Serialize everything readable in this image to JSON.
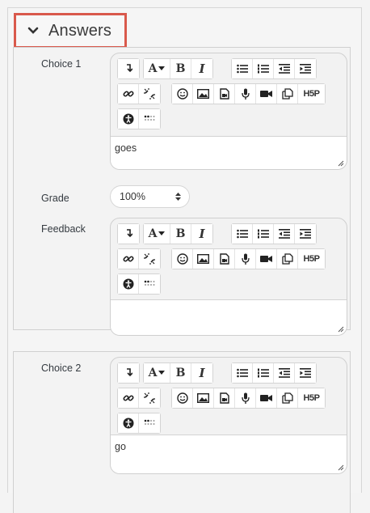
{
  "section": {
    "title": "Answers"
  },
  "choices": [
    {
      "label": "Choice 1",
      "answer_text": "goes",
      "grade_label": "Grade",
      "grade_value": "100%",
      "feedback_label": "Feedback",
      "feedback_text": ""
    },
    {
      "label": "Choice 2",
      "answer_text": "go"
    }
  ],
  "toolbar": {
    "font_size_label": "A",
    "bold_label": "B",
    "italic_label": "I",
    "h5p_label": "H5P"
  },
  "colors": {
    "highlight": "#d9594c",
    "panel": "#f3f3f3",
    "border": "#d0d0d0"
  }
}
